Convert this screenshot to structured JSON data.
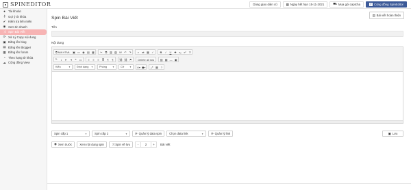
{
  "logo": {
    "text": "SPINEDITOR"
  },
  "topbar": {
    "theme_btn": "Dùng giao diện cũ",
    "expiry_btn": "Ngày hết hạn 15-11-2021",
    "captcha_btn": "Mua gói captcha",
    "community_btn": "Cộng đồng SpinEditor"
  },
  "sidebar": {
    "items": [
      {
        "label": "Tài khoản",
        "icon": "user-icon",
        "glyph": "●"
      },
      {
        "label": "Gợi ý từ khóa",
        "icon": "key-icon",
        "glyph": "⚷"
      },
      {
        "label": "Kiểm tra liên miền",
        "icon": "check-icon",
        "glyph": "✔"
      },
      {
        "label": "Xem tin nhanh",
        "icon": "eye-icon",
        "glyph": "◉"
      },
      {
        "label": "Spin Bài Viết",
        "icon": "shuffle-icon",
        "glyph": "⤨"
      },
      {
        "label": "Xử Lý Copy nội dung",
        "icon": "refresh-icon",
        "glyph": "⟳"
      },
      {
        "label": "Đăng lên blog",
        "icon": "blog-icon",
        "glyph": "▣"
      },
      {
        "label": "Đăng lên Blogger",
        "icon": "blogger-icon",
        "glyph": "▤"
      },
      {
        "label": "Đăng lên forum",
        "icon": "forum-icon",
        "glyph": "▦"
      },
      {
        "label": "Theo hạng từ khóa",
        "icon": "rank-icon",
        "glyph": "◔"
      },
      {
        "label": "Cộng đồng View",
        "icon": "community-icon",
        "glyph": "☁"
      }
    ],
    "active_index": 4
  },
  "main": {
    "title": "Spin Bài Viết",
    "summary_btn": "Bài viết hoàn thiện",
    "title_label": "Tên",
    "content_label": "Nội dung",
    "toolbar": {
      "source_btn": "Mã HTML",
      "row2_btn": "Delete all sns",
      "format_select": "Kiểu",
      "style_select": "Định dạng",
      "font_select": "Phông",
      "size_select": "Cỡ"
    },
    "controls": {
      "spin_level_1": "Spin cấp 1",
      "spin_level_2": "Spin cấp 2",
      "manage_data_btn": "Quản lý data spin",
      "select_data": "Chọn data link",
      "manage_link_btn": "Quản lý link",
      "save_btn": "Lưu",
      "preview_btn": "Xem trước",
      "view_spin_btn": "Xem nội dung spin",
      "spin_to_btn": "Spin về lưu",
      "step_minus": "-",
      "step_value": "2",
      "step_plus": "+",
      "unit": "Bài viết"
    }
  }
}
